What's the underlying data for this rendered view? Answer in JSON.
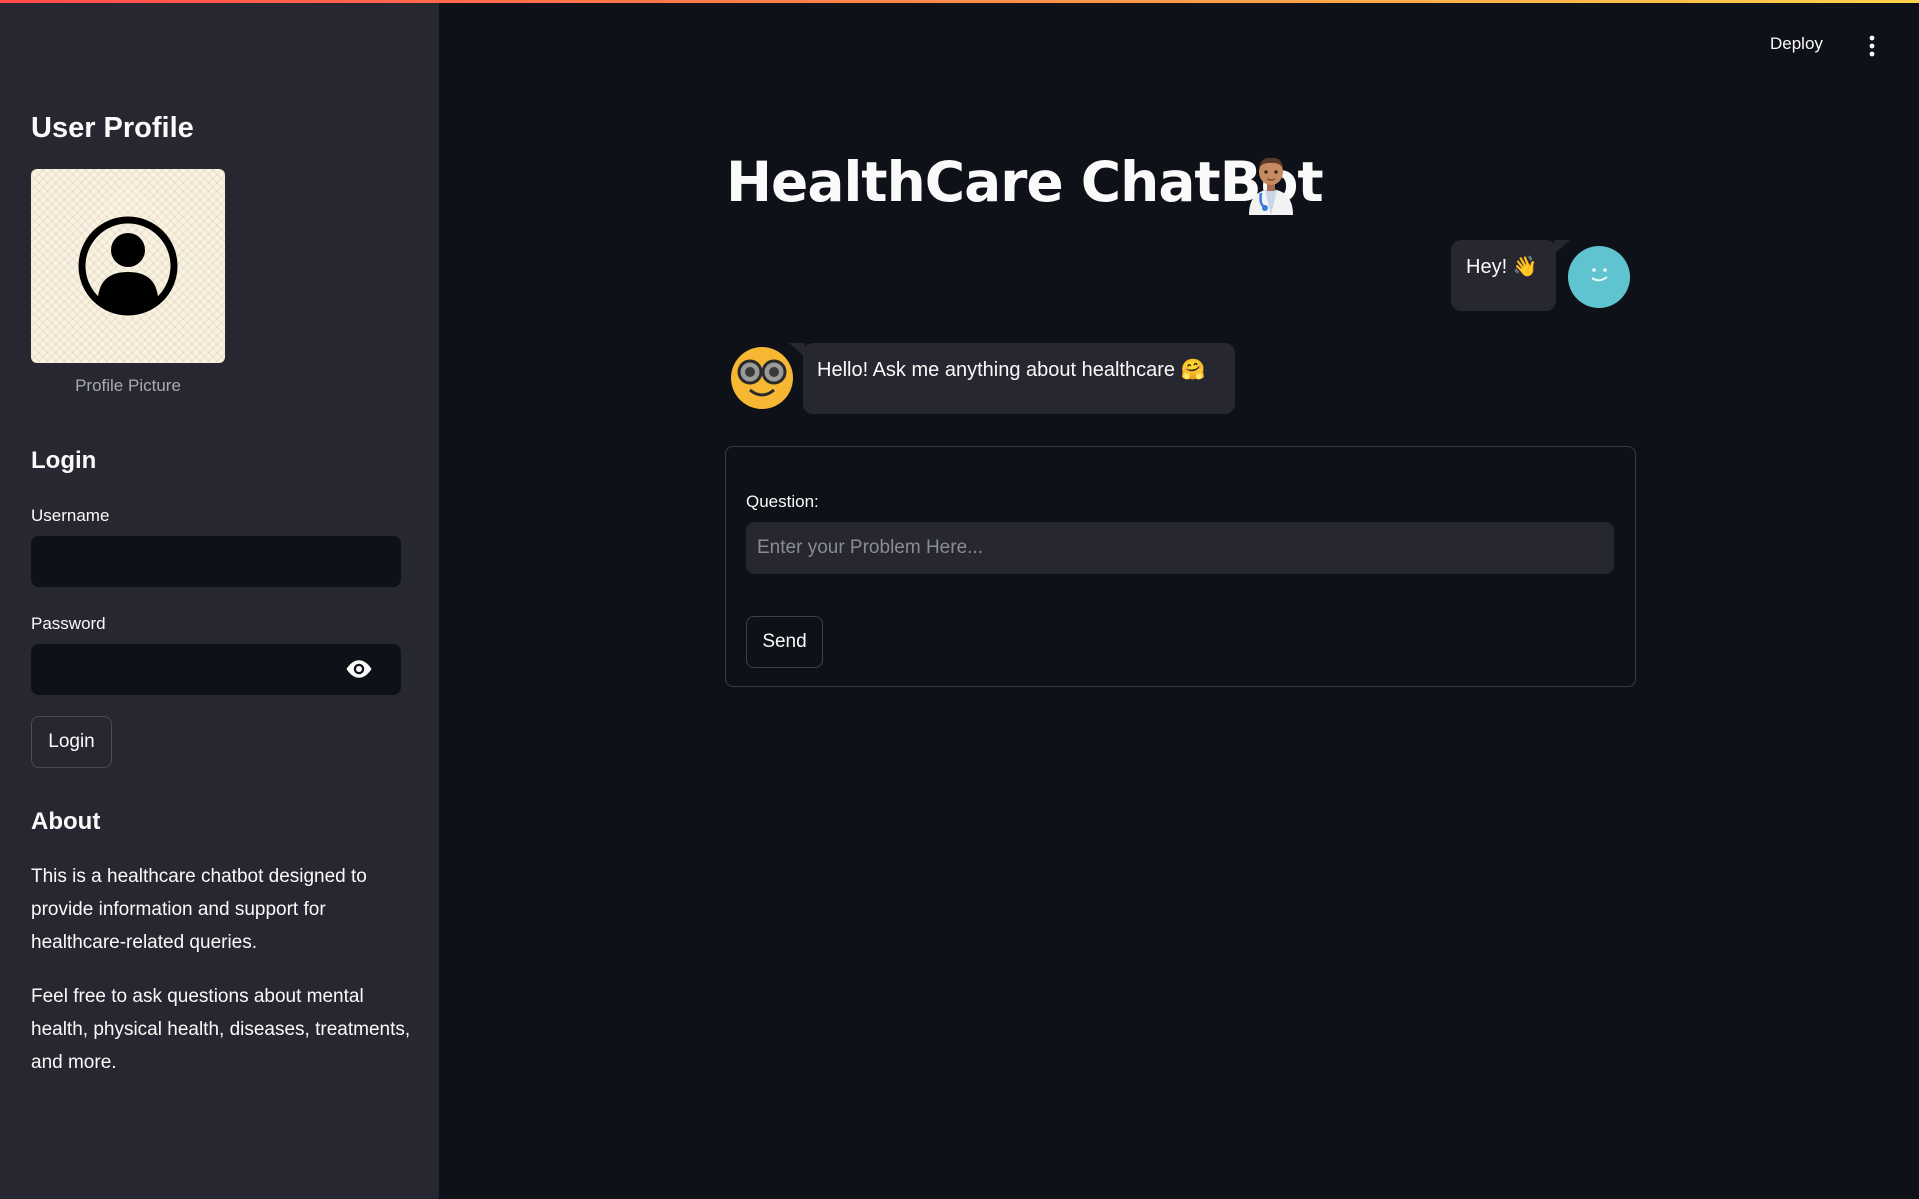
{
  "header": {
    "deploy_label": "Deploy",
    "menu_icon": "kebab-menu-icon"
  },
  "sidebar": {
    "title": "User Profile",
    "profile_caption": "Profile Picture",
    "login": {
      "title": "Login",
      "username_label": "Username",
      "username_value": "",
      "password_label": "Password",
      "password_value": "",
      "button_label": "Login"
    },
    "about": {
      "title": "About",
      "paragraph1": "This is a healthcare chatbot designed to provide information and support for healthcare-related queries.",
      "paragraph2": "Feel free to ask questions about mental health, physical health, diseases, treatments, and more."
    }
  },
  "main": {
    "title": "HealthCare ChatBot",
    "title_icon": "doctor-icon",
    "messages": [
      {
        "role": "user",
        "text": "Hey! 👋"
      },
      {
        "role": "bot",
        "text": "Hello! Ask me anything about healthcare 🤗"
      }
    ],
    "form": {
      "question_label": "Question:",
      "question_placeholder": "Enter your Problem Here...",
      "question_value": "",
      "send_label": "Send"
    }
  },
  "colors": {
    "background": "#0e1117",
    "sidebar": "#262730",
    "accent_start": "#ff4b4b",
    "accent_end": "#ffd24b",
    "user_avatar": "#5fc4cf",
    "bot_avatar": "#f6b733"
  }
}
